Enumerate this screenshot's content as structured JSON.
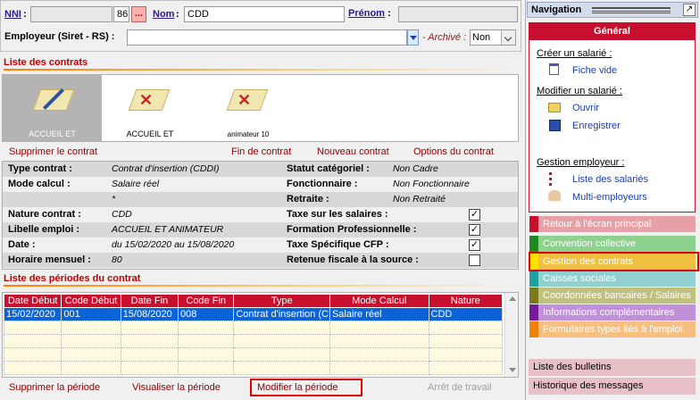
{
  "header": {
    "nni_label": "NNI",
    "nni_key": "86",
    "nni_ellipsis": "...",
    "nom_label": "Nom",
    "nom_value": "CDD",
    "prenom_label": "Prénom",
    "employeur_label": "Employeur (Siret - RS) :",
    "archive_label": "- Archivé :",
    "archive_value": "Non"
  },
  "contracts": {
    "title": "Liste des contrats",
    "items": [
      {
        "label": "ACCUEIL ET"
      },
      {
        "label": "ACCUEIL ET"
      },
      {
        "label": "animateur 10"
      }
    ],
    "actions": {
      "delete": "Supprimer le contrat",
      "end": "Fin de contrat",
      "new": "Nouveau contrat",
      "options": "Options du contrat"
    }
  },
  "details": {
    "type_contrat_label": "Type contrat :",
    "type_contrat_value": "Contrat d'insertion (CDDI)",
    "statut_label": "Statut catégoriel :",
    "statut_value": "Non Cadre",
    "mode_calcul_label": "Mode calcul :",
    "mode_calcul_value": "Salaire réel",
    "fonctionnaire_label": "Fonctionnaire :",
    "fonctionnaire_value": "Non Fonctionnaire",
    "asterisk": "*",
    "retraite_label": "Retraite :",
    "retraite_value": "Non Retraité",
    "nature_label": "Nature contrat :",
    "nature_value": "CDD",
    "taxe_salaires_label": "Taxe sur les salaires :",
    "taxe_salaires_checked": true,
    "libelle_label": "Libelle emploi :",
    "libelle_value": "ACCUEIL ET ANIMATEUR",
    "formation_label": "Formation Professionnelle :",
    "formation_checked": true,
    "date_label": "Date :",
    "date_value": "du 15/02/2020 au 15/08/2020",
    "cfp_label": "Taxe Spécifique CFP :",
    "cfp_checked": true,
    "horaire_label": "Horaire mensuel :",
    "horaire_value": "80",
    "retenue_label": "Retenue fiscale à la source :",
    "retenue_checked": false,
    "check_mark": "✓"
  },
  "periods": {
    "title": "Liste des périodes du contrat",
    "columns": [
      "Date Début",
      "Code Début",
      "Date Fin",
      "Code Fin",
      "Type",
      "Mode Calcul",
      "Nature"
    ],
    "rows": [
      [
        "15/02/2020",
        "001",
        "15/08/2020",
        "008",
        "Contrat d'insertion (CDDI)",
        "Salaire réel",
        "CDD"
      ]
    ],
    "actions": {
      "delete": "Supprimer la période",
      "view": "Visualiser la période",
      "modify": "Modifier la période",
      "stop": "Arrêt de travail"
    }
  },
  "nav": {
    "title": "Navigation",
    "general": "Général",
    "creer_head": "Créer un salarié :",
    "fiche_vide": "Fiche vide",
    "modifier_head": "Modifier un salarié :",
    "ouvrir": "Ouvrir",
    "enregistrer": "Enregistrer",
    "gestion_head": "Gestion employeur :",
    "liste_salaries": "Liste des salariés",
    "multi_employeurs": "Multi-employeurs",
    "menu": [
      {
        "label": "Retour à l'écran principal",
        "color": "#c8102e",
        "bg": "#e8a0a8"
      },
      {
        "label": "Convention collective",
        "color": "#1e8a1e",
        "bg": "#8ed08e"
      },
      {
        "label": "Gestion des contrats",
        "color": "#ffe000",
        "bg": "#f0c040"
      },
      {
        "label": "Caisses sociales",
        "color": "#20a0a0",
        "bg": "#90d0d0"
      },
      {
        "label": "Coordonnées bancaires / Salaires",
        "color": "#7a7a1a",
        "bg": "#c0c080"
      },
      {
        "label": "Informations complémentaires",
        "color": "#7a1a9a",
        "bg": "#c090d8"
      },
      {
        "label": "Formulaires types liés à l'emploi",
        "color": "#f08000",
        "bg": "#f8c080"
      }
    ],
    "bulletins": "Liste des bulletins",
    "historique": "Historique des messages"
  }
}
